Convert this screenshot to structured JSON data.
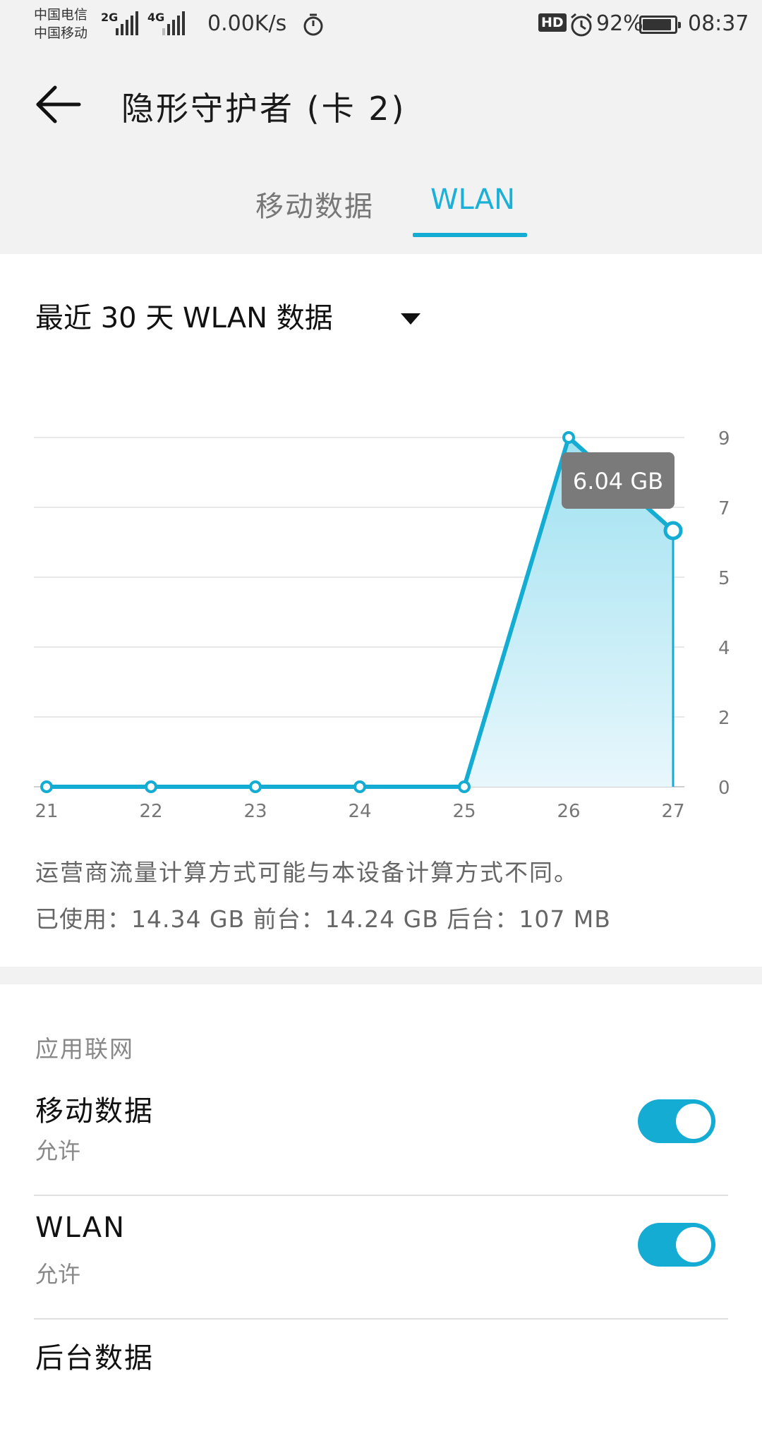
{
  "status_bar": {
    "carrier1": "中国电信",
    "carrier2": "中国移动",
    "net1": "2G",
    "net2": "4G",
    "speed": "0.00K/s",
    "hd_badge": "HD",
    "battery_percent": "92%",
    "battery_level": 0.92,
    "time": "08:37",
    "icons": [
      "signal-icon",
      "timer-icon",
      "alarm-icon",
      "battery-icon"
    ]
  },
  "header": {
    "title": "隐形守护者 (卡 2)",
    "back_icon": "back-arrow-icon"
  },
  "tabs": [
    {
      "label": "移动数据",
      "active": false
    },
    {
      "label": "WLAN",
      "active": true
    }
  ],
  "selector": {
    "label": "最近 30 天 WLAN 数据",
    "caret_icon": "dropdown-caret-icon"
  },
  "chart_data": {
    "type": "area",
    "title": "",
    "xlabel": "",
    "ylabel": "",
    "x": [
      "21",
      "22",
      "23",
      "24",
      "25",
      "26",
      "27"
    ],
    "values": [
      0,
      0,
      0,
      0,
      0,
      9,
      6.6
    ],
    "y_ticks": [
      "0",
      "2",
      "4",
      "5",
      "7",
      "9"
    ],
    "ylim": [
      0,
      9
    ],
    "grid": true,
    "tooltip": {
      "text": "6.04 GB",
      "index": 6
    },
    "colors": {
      "line": "#14acd3",
      "fill_top": "#9fe1f1",
      "fill_bottom": "#e8f7fc",
      "grid": "#e8e8e8"
    }
  },
  "info": {
    "note": "运营商流量计算方式可能与本设备计算方式不同。",
    "usage": "已使用：14.34 GB 前台：14.24 GB 后台：107 MB"
  },
  "app_network": {
    "header": "应用联网",
    "rows": [
      {
        "title": "移动数据",
        "subtitle": "允许",
        "enabled": true
      },
      {
        "title": "WLAN",
        "subtitle": "允许",
        "enabled": true
      },
      {
        "title": "后台数据",
        "subtitle": "",
        "enabled": true
      }
    ]
  },
  "colors": {
    "accent": "#14acd3",
    "background": "#f2f2f2"
  }
}
